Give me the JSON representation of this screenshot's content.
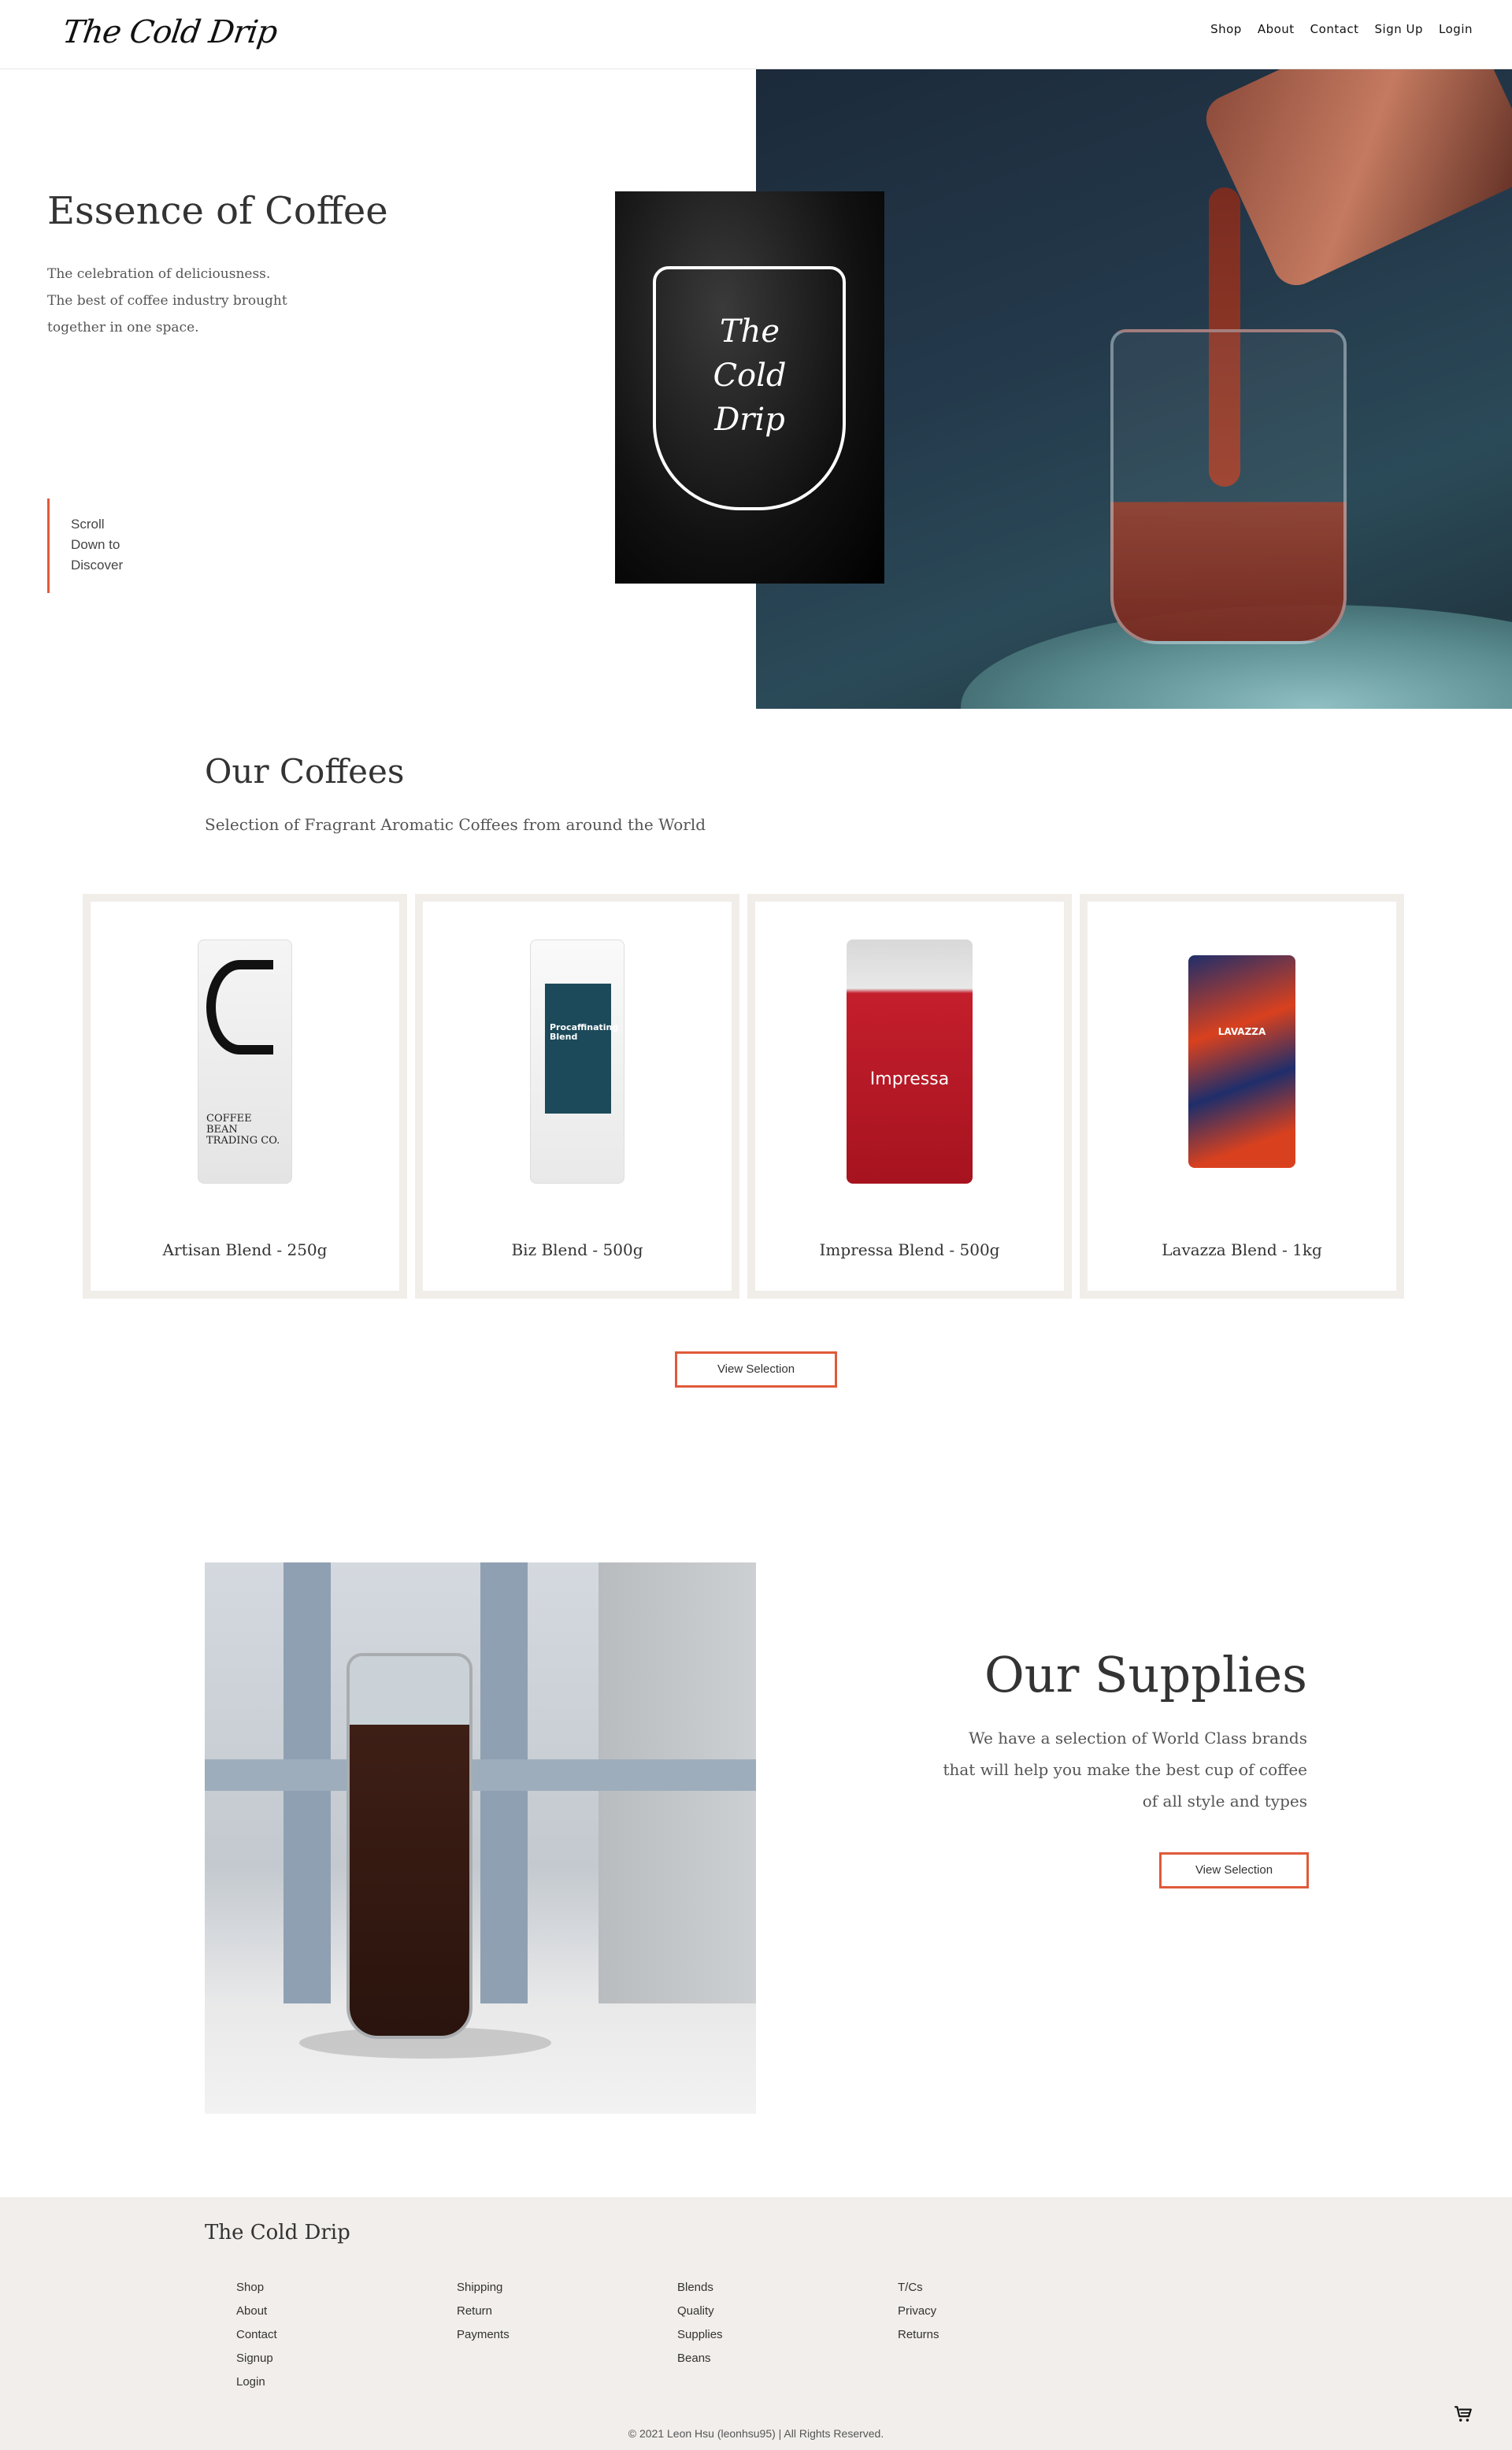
{
  "header": {
    "logo": "The Cold Drip",
    "nav": [
      "Shop",
      "About",
      "Contact",
      "Sign Up",
      "Login"
    ]
  },
  "hero": {
    "title": "Essence of Coffee",
    "lines": [
      "The celebration of deliciousness.",
      "The best of coffee industry brought",
      "together in one space."
    ],
    "scroll_lines": [
      "Scroll",
      "Down to",
      "Discover"
    ],
    "card_logo": [
      "The",
      "Cold",
      "Drip"
    ]
  },
  "coffees": {
    "title": "Our Coffees",
    "subtitle": "Selection of Fragrant Aromatic Coffees from around the World",
    "products": [
      {
        "name": "Artisan Blend - 250g",
        "bag_text": "COFFEE BEAN TRADING CO."
      },
      {
        "name": "Biz Blend - 500g",
        "bag_text": "Procaffinating Blend"
      },
      {
        "name": "Impressa Blend - 500g",
        "bag_text": "Impressa"
      },
      {
        "name": "Lavazza Blend - 1kg",
        "bag_text": "LAVAZZA"
      }
    ],
    "button": "View Selection"
  },
  "supplies": {
    "title": "Our Supplies",
    "lines": [
      "We have a selection of World Class brands",
      "that will help you make the best cup of coffee",
      "of all style and types"
    ],
    "button": "View Selection"
  },
  "footer": {
    "brand": "The Cold Drip",
    "col1": [
      "Shop",
      "About",
      "Contact",
      "Signup",
      "Login"
    ],
    "col2": [
      "Shipping",
      "Return",
      "Payments"
    ],
    "col3": [
      "Blends",
      "Quality",
      "Supplies",
      "Beans"
    ],
    "col4": [
      "T/Cs",
      "Privacy",
      "Returns"
    ],
    "copyright": "© 2021 Leon Hsu (leonhsu95) | All Rights Reserved.",
    "cart_icon": "cart-icon"
  },
  "colors": {
    "accent": "#e05a3a",
    "footer_bg": "#f1eeeb",
    "card_border": "#f1eee9"
  }
}
